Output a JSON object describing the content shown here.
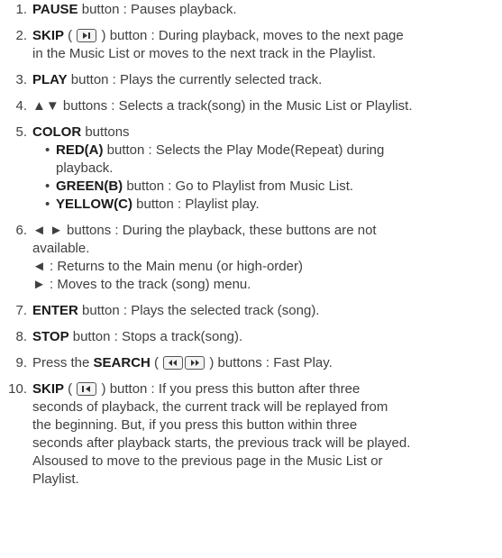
{
  "items": [
    {
      "num": "1.",
      "bold": "PAUSE",
      "text": " button : Pauses playback."
    },
    {
      "num": "2.",
      "bold": "SKIP",
      "pre_icon": " ( ",
      "post_icon": " ) button : During playback, moves to the next page",
      "line2": "in the Music List or moves to the next track in the Playlist.",
      "icon": "skip-next-icon"
    },
    {
      "num": "3.",
      "bold": "PLAY",
      "text": " button : Plays the currently selected track."
    },
    {
      "num": "4.",
      "text": "▲▼ buttons : Selects a track(song) in the Music List or Playlist."
    },
    {
      "num": "5.",
      "bold": "COLOR",
      "text": " buttons"
    },
    {
      "bullet": "•",
      "bold": "RED(A)",
      "text": " button : Selects the Play Mode(Repeat) during",
      "line2": "playback."
    },
    {
      "bullet": "•",
      "bold": "GREEN(B)",
      "text": " button : Go to Playlist from Music List."
    },
    {
      "bullet": "•",
      "bold": "YELLOW(C)",
      "text": " button : Playlist play."
    },
    {
      "num": "6.",
      "text": "◄ ► buttons : During the playback, these buttons are not",
      "line2": "available."
    },
    {
      "text": "◄ : Returns to the Main menu (or high-order)"
    },
    {
      "text": "► : Moves to the track (song) menu."
    },
    {
      "num": "7.",
      "bold": "ENTER",
      "text": " button : Plays the selected track (song)."
    },
    {
      "num": "8.",
      "bold": "STOP",
      "text": " button : Stops a track(song)."
    },
    {
      "num": "9.",
      "pre": "Press the ",
      "bold": "SEARCH",
      "pre_icon": " ( ",
      "post_icon": " ) buttons : Fast Play.",
      "icon1": "rewind-icon",
      "icon2": "fast-forward-icon"
    },
    {
      "num": "10.",
      "bold": "SKIP",
      "pre_icon": " ( ",
      "post_icon": " ) button : If you press this button after three",
      "icon": "skip-previous-icon"
    },
    {
      "text": "seconds of playback, the current track will be replayed from"
    },
    {
      "text": "the beginning. But, if you press this button within three"
    },
    {
      "text": "seconds after playback starts, the previous track will be played."
    },
    {
      "text": "Alsoused to move to the previous page in the Music List or"
    },
    {
      "text": "Playlist."
    }
  ]
}
